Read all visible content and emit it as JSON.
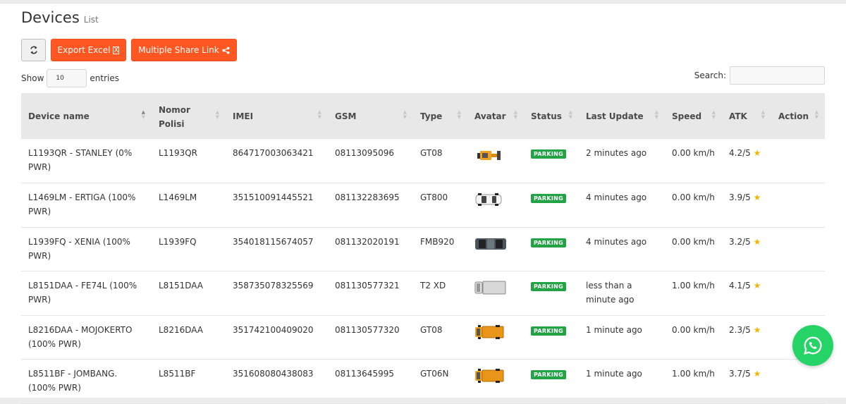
{
  "page": {
    "title": "Devices",
    "subtitle": "List"
  },
  "toolbar": {
    "refresh_icon": "refresh-icon",
    "export_label": "Export Excel",
    "share_label": "Multiple Share Link"
  },
  "entries": {
    "show_label": "Show",
    "value": "10",
    "suffix": "entries"
  },
  "search": {
    "label": "Search:",
    "placeholder": ""
  },
  "table": {
    "headers": [
      "Device name",
      "Nomor Polisi",
      "IMEI",
      "GSM",
      "Type",
      "Avatar",
      "Status",
      "Last Update",
      "Speed",
      "ATK",
      "Action"
    ],
    "rows": [
      {
        "device": "L1193QR - STANLEY (0% PWR)",
        "nopol": "L1193QR",
        "imei": "864717003063421",
        "gsm": "08113095096",
        "type": "GT08",
        "avatar": "excavator-icon",
        "status": "PARKING",
        "update": "2 minutes ago",
        "speed": "0.00 km/h",
        "atk": "4.2/5"
      },
      {
        "device": "L1469LM - ERTIGA (100% PWR)",
        "nopol": "L1469LM",
        "imei": "351510091445521",
        "gsm": "081132283695",
        "type": "GT800",
        "avatar": "car-white-icon",
        "status": "PARKING",
        "update": "4 minutes ago",
        "speed": "0.00 km/h",
        "atk": "3.9/5"
      },
      {
        "device": "L1939FQ - XENIA (100% PWR)",
        "nopol": "L1939FQ",
        "imei": "354018115674057",
        "gsm": "081132020191",
        "type": "FMB920",
        "avatar": "car-dark-icon",
        "status": "PARKING",
        "update": "4 minutes ago",
        "speed": "0.00 km/h",
        "atk": "3.2/5"
      },
      {
        "device": "L8151DAA - FE74L (100% PWR)",
        "nopol": "L8151DAA",
        "imei": "358735078325569",
        "gsm": "081130577321",
        "type": "T2 XD",
        "avatar": "truck-gray-icon",
        "status": "PARKING",
        "update": "less than a minute ago",
        "speed": "1.00 km/h",
        "atk": "4.1/5"
      },
      {
        "device": "L8216DAA - MOJOKERTO (100% PWR)",
        "nopol": "L8216DAA",
        "imei": "351742100409020",
        "gsm": "081130577320",
        "type": "GT08",
        "avatar": "truck-orange-icon",
        "status": "PARKING",
        "update": "1 minute ago",
        "speed": "0.00 km/h",
        "atk": "2.3/5"
      },
      {
        "device": "L8511BF - JOMBANG. (100% PWR)",
        "nopol": "L8511BF",
        "imei": "351608080438083",
        "gsm": "08113645995",
        "type": "GT06N",
        "avatar": "truck-orange-icon",
        "status": "PARKING",
        "update": "1 minute ago",
        "speed": "1.00 km/h",
        "atk": "3.7/5"
      }
    ]
  },
  "colors": {
    "accent": "#ff5722",
    "status_parking": "#22a344",
    "whatsapp": "#25d366",
    "star": "#f5b400"
  },
  "floating": {
    "icon": "whatsapp-icon"
  }
}
